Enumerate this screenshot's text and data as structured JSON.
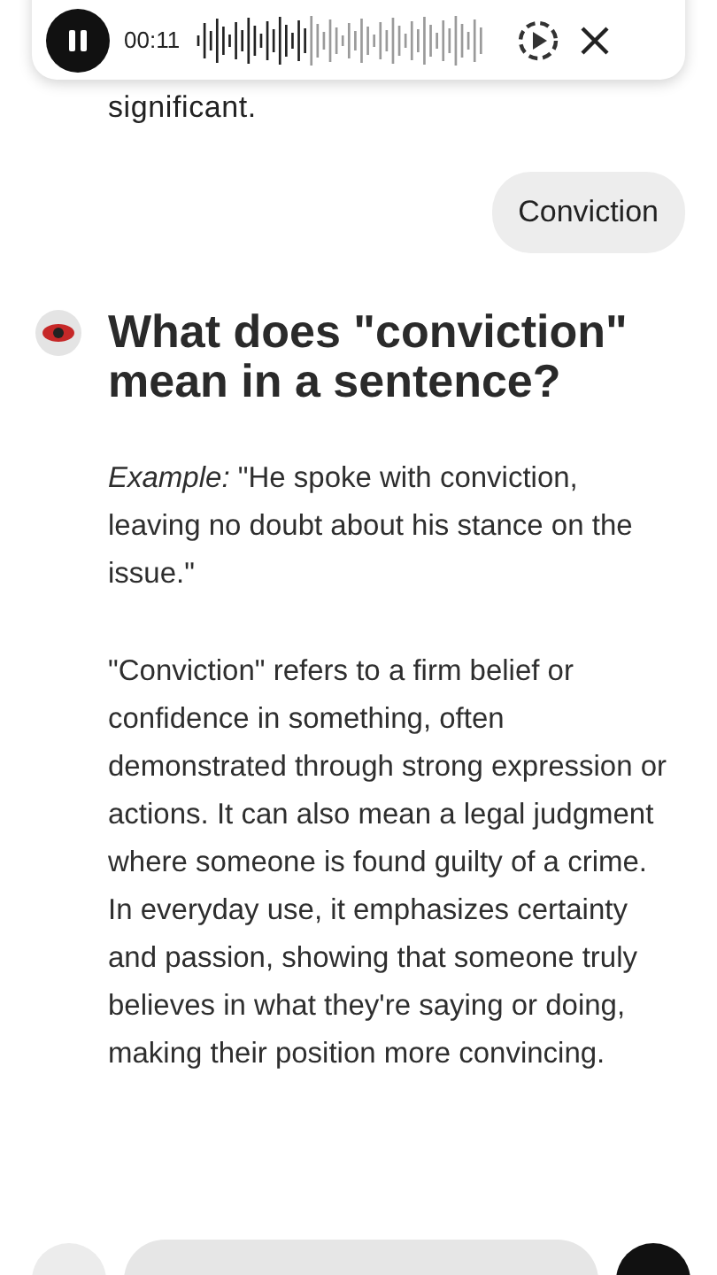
{
  "player": {
    "time": "00:11"
  },
  "partial_text": "significant.",
  "user_message": "Conviction",
  "answer": {
    "heading": "What does \"conviction\" mean in a sentence?",
    "paragraphs": [
      "*Example:* \"He spoke with conviction, leaving no doubt about his stance on the issue.\"",
      "\"Conviction\" refers to a firm belief or confidence in something, often demonstrated through strong expression or actions. It can also mean a legal judgment where someone is found guilty of a crime. In everyday use, it emphasizes certainty and passion, showing that someone truly believes in what they're saying or doing, making their position more convincing."
    ]
  }
}
